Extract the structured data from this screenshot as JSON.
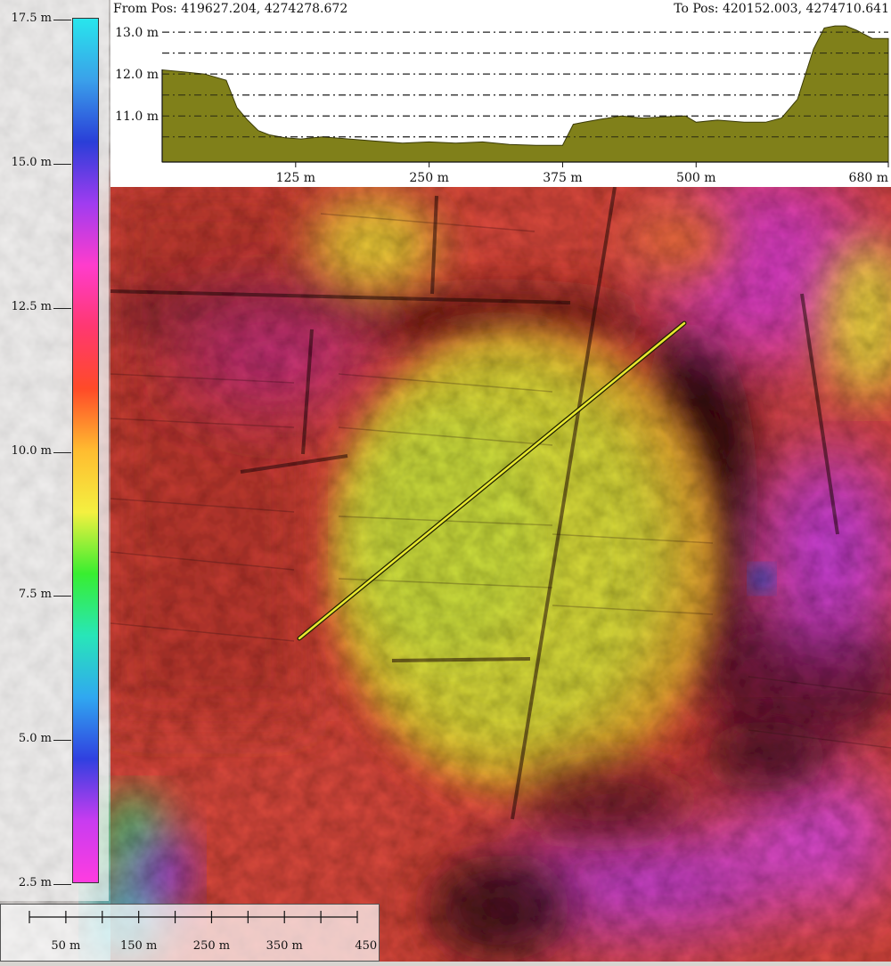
{
  "profile": {
    "from_label": "From Pos: 419627.204, 4274278.672",
    "to_label": "To Pos: 420152.003, 4274710.641",
    "y_ticks": [
      "13.0 m",
      "12.0 m",
      "11.0 m"
    ],
    "x_ticks": [
      "125 m",
      "250 m",
      "375 m",
      "500 m",
      "680 m"
    ],
    "fill_color": "#80801a",
    "chart_data": {
      "type": "area",
      "xlabel": "",
      "ylabel": "",
      "ylim": [
        9.9,
        13.3
      ],
      "xlim": [
        0,
        680
      ],
      "x": [
        0,
        20,
        40,
        60,
        70,
        80,
        90,
        100,
        115,
        130,
        150,
        175,
        200,
        225,
        250,
        275,
        300,
        325,
        350,
        365,
        375,
        385,
        395,
        410,
        430,
        450,
        470,
        490,
        500,
        520,
        545,
        565,
        580,
        595,
        610,
        620,
        630,
        640,
        650,
        665,
        680
      ],
      "y": [
        12.1,
        12.05,
        12.0,
        11.85,
        11.2,
        10.9,
        10.65,
        10.55,
        10.48,
        10.45,
        10.5,
        10.45,
        10.4,
        10.35,
        10.38,
        10.35,
        10.38,
        10.32,
        10.3,
        10.3,
        10.3,
        10.8,
        10.85,
        10.92,
        11.0,
        10.95,
        10.98,
        11.0,
        10.85,
        10.9,
        10.85,
        10.85,
        10.95,
        11.4,
        12.6,
        13.1,
        13.15,
        13.15,
        13.05,
        12.85,
        12.85
      ]
    }
  },
  "legend": {
    "labels": [
      "17.5 m",
      "15.0 m",
      "12.5 m",
      "10.0 m",
      "7.5 m",
      "5.0 m",
      "2.5 m"
    ],
    "values": [
      17.5,
      15.0,
      12.5,
      10.0,
      7.5,
      5.0,
      2.5
    ],
    "range": [
      2.5,
      17.5
    ],
    "gradient_colors": [
      "#28e6ec",
      "#3aa0ea",
      "#2a3ed8",
      "#a03cf0",
      "#ff3ccc",
      "#ff3870",
      "#ff4a28",
      "#ffbc30",
      "#f4f040",
      "#38ee30",
      "#28e6b8",
      "#30a8f0",
      "#3040e0",
      "#c83cf0",
      "#ff3ce0"
    ]
  },
  "scale_bar": {
    "labels": [
      "50 m",
      "150 m",
      "250 m",
      "350 m",
      "450 m"
    ]
  },
  "map": {
    "line_color": "#e8e830"
  }
}
